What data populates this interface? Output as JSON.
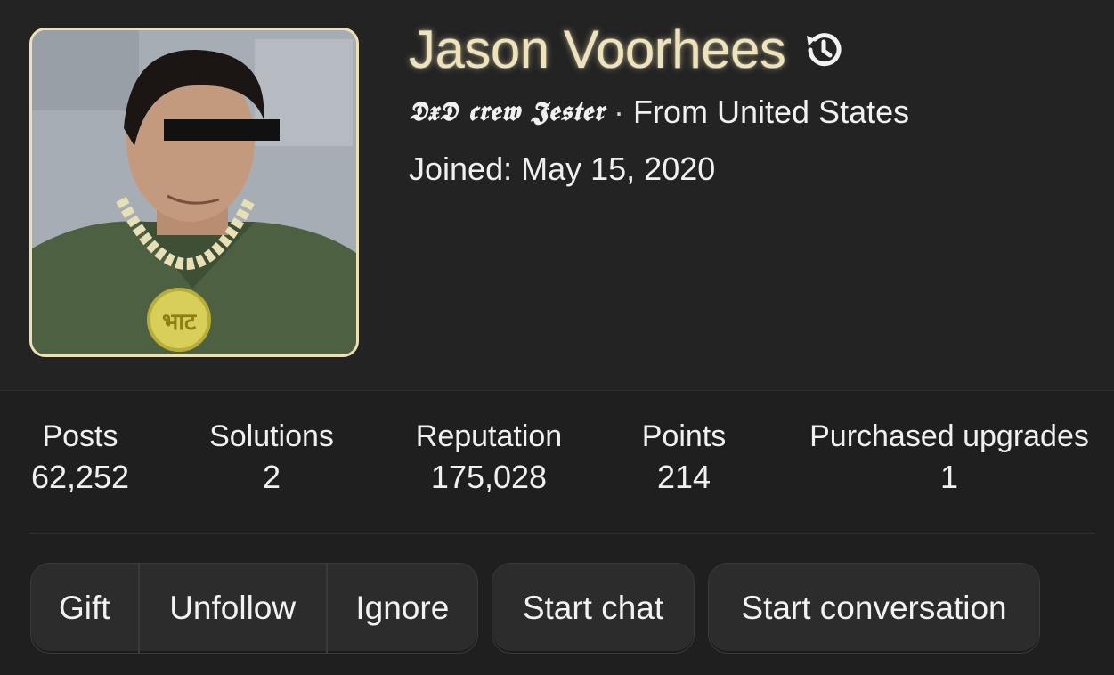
{
  "profile": {
    "username": "Jason Voorhees",
    "user_title": "𝕯𝖝𝕯 𝖈𝖗𝖊𝖜 𝕵𝖊𝖘𝖙𝖊𝖗",
    "separator": "·",
    "location": "From United States",
    "joined_label": "Joined:",
    "joined_date": "May 15, 2020",
    "username_color": "#eee3bd",
    "avatar_border_color": "#ece0b4",
    "history_icon": "history-icon"
  },
  "stats": [
    {
      "label": "Posts",
      "value": "62,252"
    },
    {
      "label": "Solutions",
      "value": "2"
    },
    {
      "label": "Reputation",
      "value": "175,028"
    },
    {
      "label": "Points",
      "value": "214"
    },
    {
      "label": "Purchased upgrades",
      "value": "1"
    }
  ],
  "actions": {
    "gift": "Gift",
    "unfollow": "Unfollow",
    "ignore": "Ignore",
    "start_chat": "Start chat",
    "start_conversation": "Start conversation"
  }
}
